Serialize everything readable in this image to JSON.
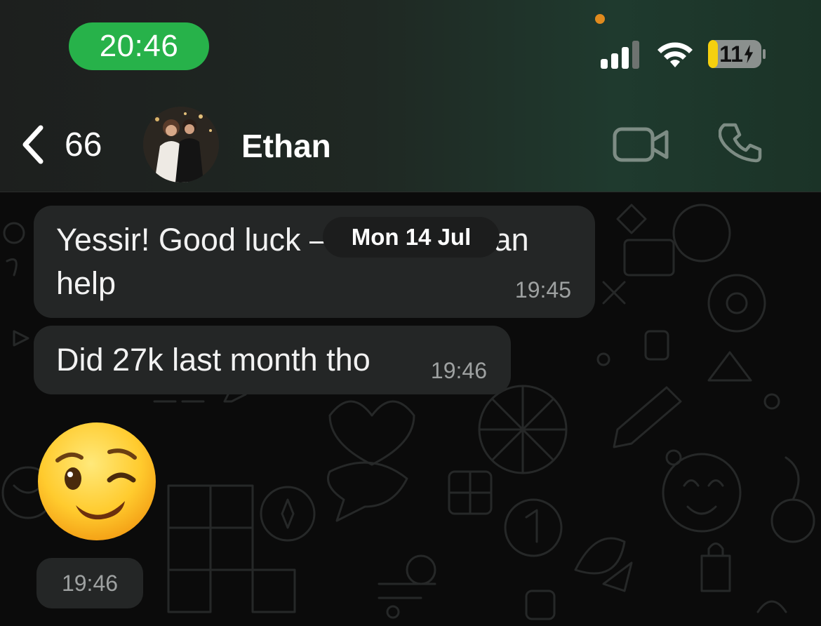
{
  "status_bar": {
    "time": "20:46",
    "battery_level": "11",
    "icons": [
      "cellular-signal-icon",
      "wifi-icon",
      "battery-charging-icon"
    ],
    "colors": {
      "time_pill": "#27b24a",
      "privacy_dot": "#e08a1e",
      "battery_fill": "#f5d00f"
    }
  },
  "chat_header": {
    "back_count": "66",
    "contact_name": "Ethan",
    "icons": [
      "chevron-left-icon",
      "video-camera-icon",
      "phone-icon"
    ]
  },
  "date_chip": "Mon 14 Jul",
  "messages": [
    {
      "text": "Yessir! Good luck – lmk how I can help",
      "time": "19:45"
    },
    {
      "text": "Did 27k last month tho",
      "time": "19:46"
    },
    {
      "emoji": "winking-face",
      "time": "19:46"
    }
  ],
  "colors": {
    "bubble_incoming": "#242626",
    "chat_background": "#0b0b0b",
    "timestamp": "#9ea1a1"
  }
}
